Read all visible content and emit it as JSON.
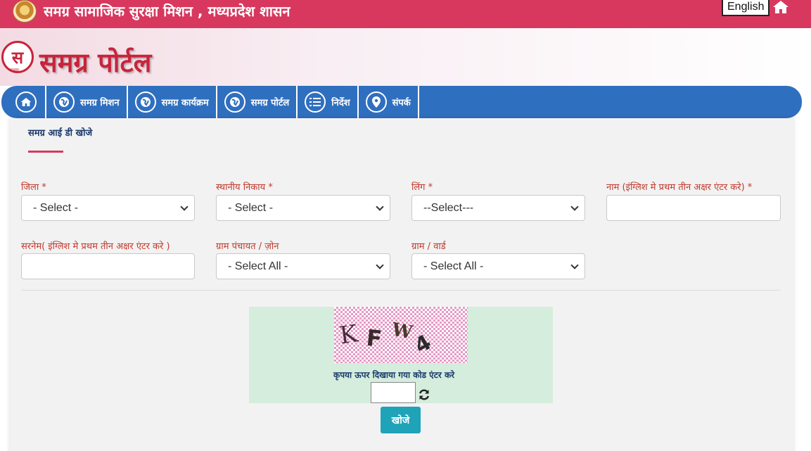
{
  "header": {
    "title": "समग्र सामाजिक सुरक्षा मिशन , मध्यप्रदेश शासन",
    "language_button": "English",
    "home_icon": "home-icon"
  },
  "brand": {
    "logo_letter": "स",
    "logo_small": "समग्र",
    "logo_text": "समग्र पोर्टल",
    "color": "#c8243c"
  },
  "nav": {
    "items": [
      {
        "label": "",
        "icon": "home-icon"
      },
      {
        "label": "समग्र मिशन",
        "icon": "globe-icon"
      },
      {
        "label": "समग्र कार्यक्रम",
        "icon": "globe-icon"
      },
      {
        "label": "समग्र पोर्टल",
        "icon": "globe-icon"
      },
      {
        "label": "निर्देश",
        "icon": "list-icon"
      },
      {
        "label": "संपर्क",
        "icon": "location-pin-icon"
      }
    ],
    "color": "#2f6fbf"
  },
  "form": {
    "title": "समग्र आई डी खोजे",
    "fields": {
      "district": {
        "label": "जिला *",
        "value": "- Select -"
      },
      "local_body": {
        "label": "स्थानीय निकाय *",
        "value": "- Select -"
      },
      "gender": {
        "label": "लिंग *",
        "value": "--Select---"
      },
      "name": {
        "label": "नाम (इंग्लिश मे प्रथम तीन अक्षर एंटर करे) *",
        "value": ""
      },
      "surname": {
        "label": "सरनेम( इंग्लिश मे प्रथम तीन अक्षर एंटर करे )",
        "value": ""
      },
      "gram_panchayat": {
        "label": "ग्राम पंचायत / ज़ोन",
        "value": "- Select All -"
      },
      "village_ward": {
        "label": "ग्राम / वार्ड",
        "value": "- Select All -"
      }
    },
    "label_color": "#c0392b"
  },
  "captcha": {
    "chars": [
      "K",
      "F",
      "W",
      "4"
    ],
    "hint": "कृपया ऊपर दिखाया गया कोड एंटर करे",
    "input_value": "",
    "refresh_icon": "refresh-icon",
    "submit_label": "खोजे",
    "background": "#d5eddc",
    "button_color": "#1fa3b8"
  }
}
